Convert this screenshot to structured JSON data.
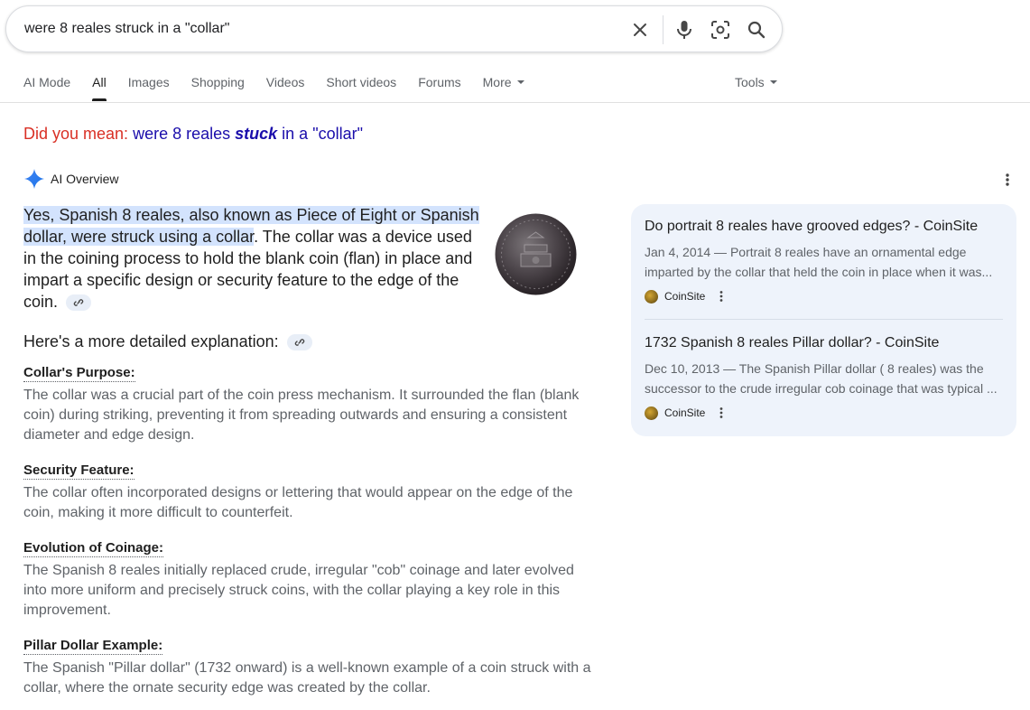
{
  "search": {
    "query": "were 8 reales struck in a \"collar\""
  },
  "tabs": [
    {
      "label": "AI Mode"
    },
    {
      "label": "All",
      "active": true
    },
    {
      "label": "Images"
    },
    {
      "label": "Shopping"
    },
    {
      "label": "Videos"
    },
    {
      "label": "Short videos"
    },
    {
      "label": "Forums"
    },
    {
      "label": "More"
    }
  ],
  "tools_label": "Tools",
  "did_you_mean": {
    "label": "Did you mean:",
    "before": "were 8 reales ",
    "bold": "stuck",
    "after": " in a \"collar\""
  },
  "ai_overview": {
    "label": "AI Overview",
    "lead_highlight": "Yes, Spanish 8 reales, also known as Piece of Eight or Spanish dollar, were struck using a collar",
    "lead_rest": ". The collar was a device used in the coining process to hold the blank coin (flan) in place and impart a specific design or security feature to the edge of the coin.",
    "more_explanation": "Here's a more detailed explanation:",
    "sections": [
      {
        "title": "Collar's Purpose:",
        "body": "The collar was a crucial part of the coin press mechanism. It surrounded the flan (blank coin) during striking, preventing it from spreading outwards and ensuring a consistent diameter and edge design."
      },
      {
        "title": "Security Feature:",
        "body": "The collar often incorporated designs or lettering that would appear on the edge of the coin, making it more difficult to counterfeit."
      },
      {
        "title": "Evolution of Coinage:",
        "body": "The Spanish 8 reales initially replaced crude, irregular \"cob\" coinage and later evolved into more uniform and precisely struck coins, with the collar playing a key role in this improvement."
      },
      {
        "title": "Pillar Dollar Example:",
        "body": "The Spanish \"Pillar dollar\" (1732 onward) is a well-known example of a coin struck with a collar, where the ornate security edge was created by the collar."
      }
    ]
  },
  "sources": [
    {
      "title": "Do portrait 8 reales have grooved edges? - CoinSite",
      "snippet_line1": "Jan 4, 2014 — Portrait 8 reales have an ornamental edge",
      "snippet_line2": "imparted by the collar that held the coin in place when it was...",
      "site": "CoinSite"
    },
    {
      "title": "1732 Spanish 8 reales Pillar dollar? - CoinSite",
      "snippet_line1": "Dec 10, 2013 — The Spanish Pillar dollar ( 8 reales) was the",
      "snippet_line2": "successor to the crude irregular cob coinage that was typical ...",
      "site": "CoinSite"
    }
  ],
  "colors": {
    "link": "#1a0dab",
    "did_you_mean": "#d93025",
    "highlight": "#d3e3fd",
    "sources_bg": "#eef3fb"
  },
  "icons": [
    "clear-icon",
    "microphone-icon",
    "lens-camera-icon",
    "search-icon",
    "ai-sparkle-icon",
    "more-vert-icon",
    "link-icon",
    "coinsite-favicon"
  ]
}
